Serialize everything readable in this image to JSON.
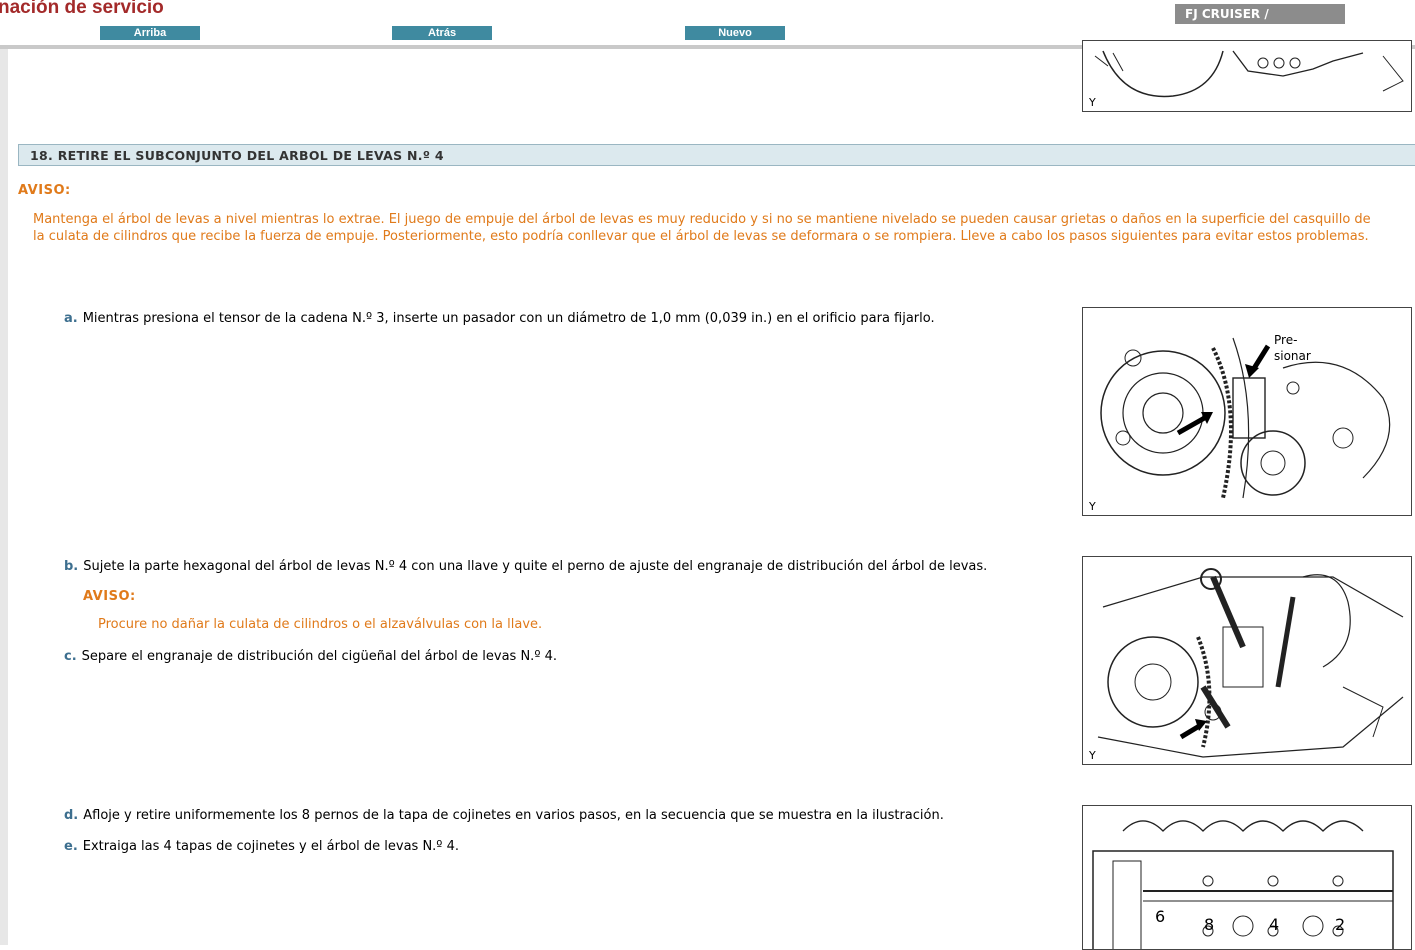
{
  "app": {
    "title": "nación de servicio",
    "model": "FJ CRUISER /"
  },
  "nav": {
    "up": "Arriba",
    "back": "Atrás",
    "new": "Nuevo"
  },
  "step": {
    "title": "18. RETIRE EL SUBCONJUNTO DEL ARBOL DE LEVAS N.º 4",
    "notice_label": "AVISO:",
    "notice_line1": "Mantenga el árbol de levas a nivel mientras lo extrae. El juego de empuje del árbol de levas es muy reducido y si no se mantiene nivelado se pueden causar grietas o daños en la superficie del casquillo de",
    "notice_line2": "la culata de cilindros que recibe la fuerza de empuje. Posteriormente, esto podría conllevar que el árbol de levas se deformara o se rompiera. Lleve a cabo los pasos siguientes para evitar estos problemas."
  },
  "substeps": [
    {
      "letter": "a.",
      "text": "Mientras presiona el tensor de la cadena N.º 3, inserte un pasador con un diámetro de 1,0 mm (0,039 in.) en el orificio para fijarlo."
    },
    {
      "letter": "b.",
      "text": "Sujete la parte hexagonal del árbol de levas N.º 4 con una llave y quite el perno de ajuste del engranaje de distribución del árbol de levas."
    },
    {
      "letter": "c.",
      "text": "Separe el engranaje de distribución del cigüeñal del árbol de levas N.º 4."
    },
    {
      "letter": "d.",
      "text": "Afloje y retire uniformemente los 8 pernos de la tapa de cojinetes en varios pasos, en la secuencia que se muestra en la ilustración."
    },
    {
      "letter": "e.",
      "text": "Extraiga las 4 tapas de cojinetes y el árbol de levas N.º 4."
    }
  ],
  "substep_b_notice": {
    "label": "AVISO:",
    "text": "Procure no dañar la culata de cilindros o el alzaválvulas con la llave."
  },
  "figures": {
    "corner_mark": "Y",
    "fig_a_label_1": "Pre-",
    "fig_a_label_2": "sionar",
    "fig_d_numbers": [
      "6",
      "8",
      "4",
      "2"
    ]
  },
  "colors": {
    "title_red": "#a32a2a",
    "nav_teal": "#3f8aa0",
    "notice_orange": "#e07a1a",
    "header_bg": "#dce9ee",
    "badge_gray": "#8c8c8c"
  }
}
